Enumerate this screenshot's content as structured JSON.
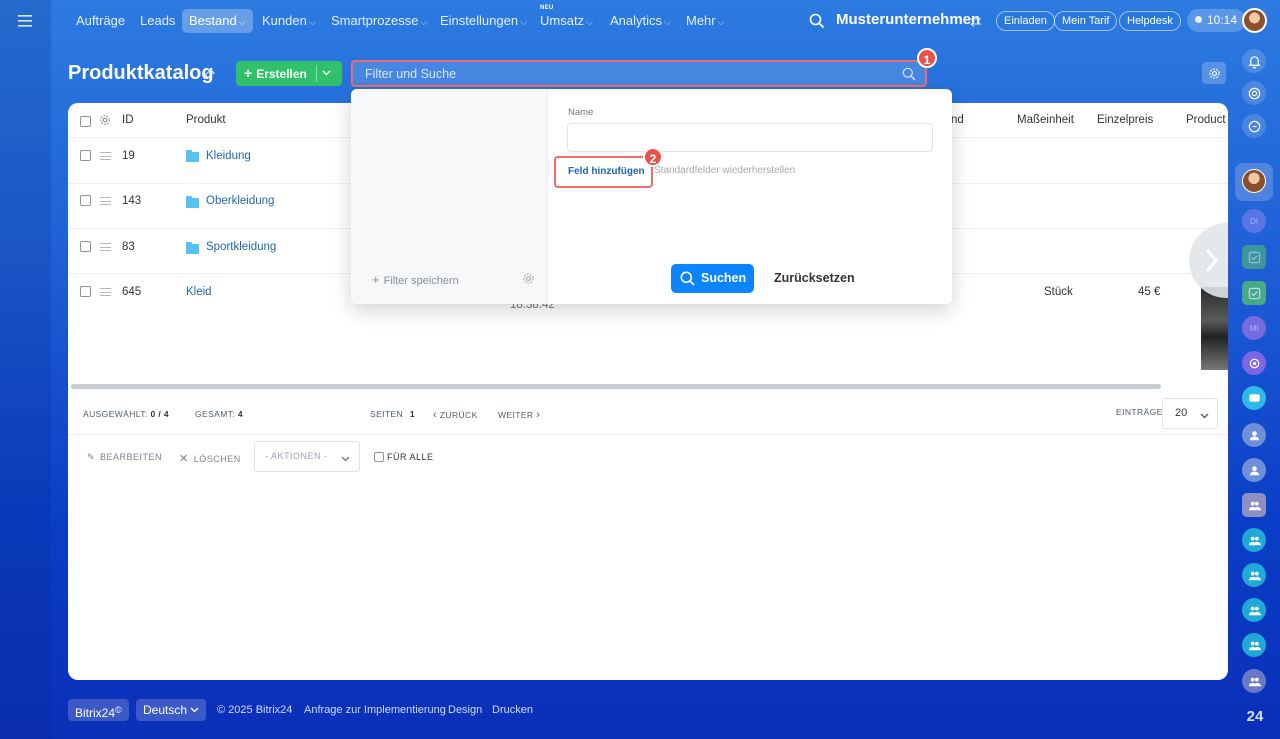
{
  "topnav": {
    "items": [
      {
        "label": "Aufträge",
        "caret": false
      },
      {
        "label": "Leads",
        "caret": false
      },
      {
        "label": "Bestand",
        "caret": true
      },
      {
        "label": "Kunden",
        "caret": true
      },
      {
        "label": "Smartprozesse",
        "caret": true
      },
      {
        "label": "Einstellungen",
        "caret": true
      },
      {
        "label": "Umsatz",
        "caret": true,
        "badge": "NEU"
      },
      {
        "label": "Analytics",
        "caret": true
      },
      {
        "label": "Mehr",
        "caret": true
      }
    ],
    "active_item": "Bestand",
    "company": "Musterunternehmen",
    "invite": "Einladen",
    "plan": "Mein Tarif",
    "helpdesk": "Helpdesk",
    "time": "10:14"
  },
  "page": {
    "title": "Produktkatalog",
    "create_label": "Erstellen",
    "search_placeholder": "Filter und Suche"
  },
  "callouts": {
    "first": "1",
    "second": "2"
  },
  "filter_popup": {
    "save_filter": "Filter speichern",
    "field_name_label": "Name",
    "add_field": "Feld hinzufügen",
    "restore_defaults": "Standardfelder wiederherstellen",
    "search_button": "Suchen",
    "reset_button": "Zurücksetzen"
  },
  "table": {
    "columns": [
      "ID",
      "Produkt",
      "nd",
      "Maßeinheit",
      "Einzelpreis",
      "Product"
    ],
    "rows": [
      {
        "id": "19",
        "name": "Kleidung",
        "folder": true
      },
      {
        "id": "143",
        "name": "Oberkleidung",
        "folder": true
      },
      {
        "id": "83",
        "name": "Sportkleidung",
        "folder": true
      },
      {
        "id": "645",
        "name": "Kleid",
        "folder": false,
        "partial_time": "18:38:42",
        "unit": "Stück",
        "price": "45 €"
      }
    ]
  },
  "pager": {
    "selected_label": "AUSGEWÄHLT:",
    "selected_value": "0 / 4",
    "total_label": "GESAMT:",
    "total_value": "4",
    "pages_label": "SEITEN",
    "pages_value": "1",
    "back": "ZURÜCK",
    "next": "WEITER",
    "entries_label": "EINTRÄGE",
    "entries_value": "20"
  },
  "actions": {
    "edit": "BEARBEITEN",
    "delete": "LÖSCHEN",
    "select": "- AKTIONEN -",
    "for_all": "FÜR ALLE"
  },
  "footer": {
    "brand": "Bitrix24",
    "language": "Deutsch",
    "copyright": "© 2025 Bitrix24",
    "links": [
      "Anfrage zur Implementierung",
      "Design",
      "Drucken"
    ]
  },
  "right_rail": {
    "avatar_initials_1": "DI",
    "avatar_initials_2": "MI",
    "brand_badge": "24"
  },
  "colors": {
    "accent": "#0b84ff",
    "create_green": "#2fc26b",
    "callout_red": "#e8524a",
    "link_blue": "#2067b0"
  }
}
